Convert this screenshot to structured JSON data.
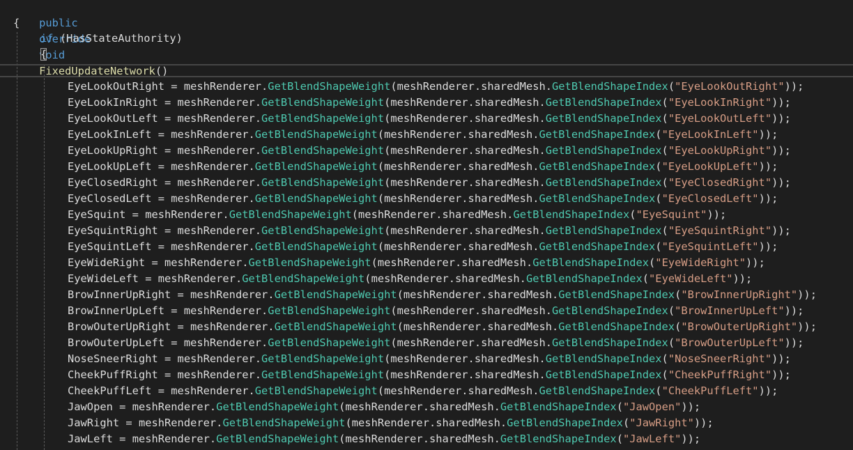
{
  "editor": {
    "signature": {
      "kw1": "public",
      "kw2": "override",
      "kw3": "void",
      "method": "FixedUpdateNetwork",
      "parens": "()"
    },
    "open_brace_outer": "{",
    "if_statement": {
      "kw": "if",
      "rest": " (HasStateAuthority)"
    },
    "open_brace_inner": "{",
    "common": {
      "eq": " = ",
      "target": "meshRenderer",
      "method1": "GetBlendShapeWeight",
      "mid": "(meshRenderer.sharedMesh.",
      "method2": "GetBlendShapeIndex",
      "open": "(",
      "close": "));"
    },
    "assignments": [
      {
        "variable": "EyeLookOutRight",
        "key": "\"EyeLookOutRight\""
      },
      {
        "variable": "EyeLookInRight",
        "key": "\"EyeLookInRight\""
      },
      {
        "variable": "EyeLookOutLeft",
        "key": "\"EyeLookOutLeft\""
      },
      {
        "variable": "EyeLookInLeft",
        "key": "\"EyeLookInLeft\""
      },
      {
        "variable": "EyeLookUpRight",
        "key": "\"EyeLookUpRight\""
      },
      {
        "variable": "EyeLookUpLeft",
        "key": "\"EyeLookUpLeft\""
      },
      {
        "variable": "EyeClosedRight",
        "key": "\"EyeClosedRight\""
      },
      {
        "variable": "EyeClosedLeft",
        "key": "\"EyeClosedLeft\""
      },
      {
        "variable": "EyeSquint",
        "key": "\"EyeSquint\""
      },
      {
        "variable": "EyeSquintRight",
        "key": "\"EyeSquintRight\""
      },
      {
        "variable": "EyeSquintLeft",
        "key": "\"EyeSquintLeft\""
      },
      {
        "variable": "EyeWideRight",
        "key": "\"EyeWideRight\""
      },
      {
        "variable": "EyeWideLeft",
        "key": "\"EyeWideLeft\""
      },
      {
        "variable": "BrowInnerUpRight",
        "key": "\"BrowInnerUpRight\""
      },
      {
        "variable": "BrowInnerUpLeft",
        "key": "\"BrowInnerUpLeft\""
      },
      {
        "variable": "BrowOuterUpRight",
        "key": "\"BrowOuterUpRight\""
      },
      {
        "variable": "BrowOuterUpLeft",
        "key": "\"BrowOuterUpLeft\""
      },
      {
        "variable": "NoseSneerRight",
        "key": "\"NoseSneerRight\""
      },
      {
        "variable": "CheekPuffRight",
        "key": "\"CheekPuffRight\""
      },
      {
        "variable": "CheekPuffLeft",
        "key": "\"CheekPuffLeft\""
      },
      {
        "variable": "JawOpen",
        "key": "\"JawOpen\""
      },
      {
        "variable": "JawRight",
        "key": "\"JawRight\""
      },
      {
        "variable": "JawLeft",
        "key": "\"JawLeft\""
      }
    ],
    "colors": {
      "background": "#1e1e1e",
      "keyword": "#569cd6",
      "method": "#dcdcaa",
      "member": "#4ec9b0",
      "string": "#d69d85",
      "identifier": "#dcdcdc"
    }
  }
}
